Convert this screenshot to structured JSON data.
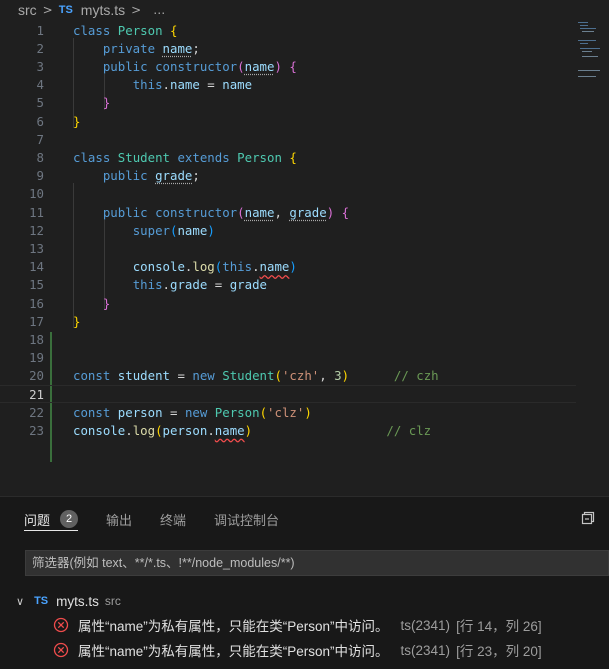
{
  "breadcrumb": {
    "folder": "src",
    "lang_badge": "TS",
    "file": "myts.ts"
  },
  "editor": {
    "line_numbers": [
      "1",
      "2",
      "3",
      "4",
      "5",
      "6",
      "7",
      "8",
      "9",
      "10",
      "11",
      "12",
      "13",
      "14",
      "15",
      "16",
      "17",
      "18",
      "19",
      "20",
      "21",
      "22",
      "23"
    ],
    "active_line": "21"
  },
  "panel": {
    "tabs": [
      {
        "label": "问题",
        "count": "2",
        "active": true
      },
      {
        "label": "输出"
      },
      {
        "label": "终端"
      },
      {
        "label": "调试控制台"
      }
    ],
    "filter_placeholder": "筛选器(例如 text、**/*.ts、!**/node_modules/**)",
    "file_group": {
      "lang_badge": "TS",
      "file": "myts.ts",
      "dir": "src"
    },
    "problems": [
      {
        "message": "属性“name”为私有属性，只能在类“Person”中访问。",
        "source": "ts(2341)",
        "location": "[行 14，列 26]"
      },
      {
        "message": "属性“name”为私有属性，只能在类“Person”中访问。",
        "source": "ts(2341)",
        "location": "[行 23，列 20]"
      }
    ]
  },
  "colors": {
    "background": "#1f1f1f",
    "keyword": "#569cd6",
    "class": "#4ec9b0",
    "function": "#dcdcaa",
    "variable": "#9cdcfe",
    "string": "#ce9178",
    "comment": "#6a9955",
    "error": "#f14c4c"
  }
}
